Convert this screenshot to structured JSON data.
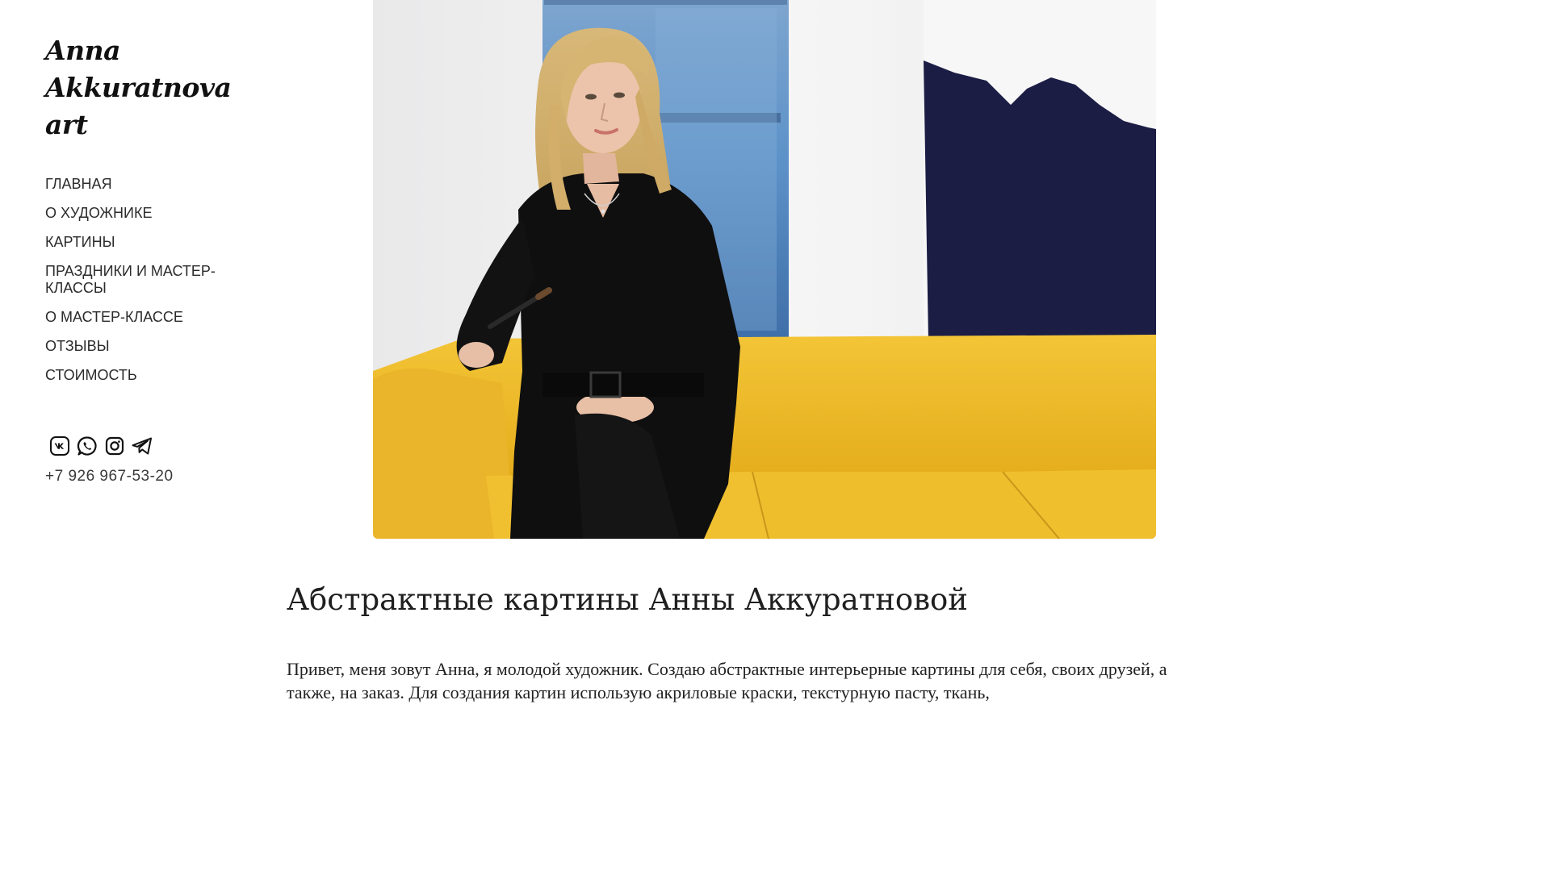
{
  "logo": {
    "lines": [
      "Anna",
      "Akkuratnova",
      "art"
    ]
  },
  "nav": {
    "items": [
      {
        "label": "ГЛАВНАЯ"
      },
      {
        "label": "О ХУДОЖНИКЕ"
      },
      {
        "label": "КАРТИНЫ"
      },
      {
        "label": "ПРАЗДНИКИ И МАСТЕР-КЛАССЫ"
      },
      {
        "label": "О МАСТЕР-КЛАССЕ"
      },
      {
        "label": "ОТЗЫВЫ"
      },
      {
        "label": "СТОИМОСТЬ"
      }
    ]
  },
  "socials": {
    "icons": [
      "vk-icon",
      "whatsapp-icon",
      "instagram-icon",
      "telegram-icon"
    ]
  },
  "contact": {
    "phone": "+7 926 967-53-20"
  },
  "main": {
    "title": "Абстрактные картины Анны Аккуратновой",
    "intro": "Привет, меня зовут Анна, я молодой художник. Создаю абстрактные интерьерные картины для себя, своих друзей, а также, на заказ. Для создания картин использую акриловые краски, текстурную пасту, ткань,"
  },
  "colors": {
    "sofa": "#f0c02e",
    "wall": "#f1f1f1",
    "painting_blue": "#6f9fcf",
    "painting_navy": "#1c1f4a",
    "text": "#2b2b2b"
  }
}
